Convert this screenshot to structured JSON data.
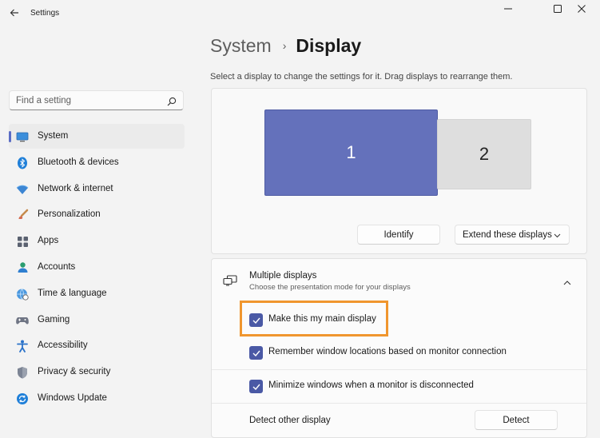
{
  "window": {
    "app_title": "Settings",
    "controls": [
      "minimize-icon",
      "maximize-icon",
      "close-icon"
    ]
  },
  "search": {
    "placeholder": "Find a setting"
  },
  "sidebar": {
    "items": [
      {
        "label": "System",
        "icon": "system-icon",
        "active": true
      },
      {
        "label": "Bluetooth & devices",
        "icon": "bluetooth-icon"
      },
      {
        "label": "Network & internet",
        "icon": "wifi-icon"
      },
      {
        "label": "Personalization",
        "icon": "brush-icon"
      },
      {
        "label": "Apps",
        "icon": "apps-icon"
      },
      {
        "label": "Accounts",
        "icon": "accounts-icon"
      },
      {
        "label": "Time & language",
        "icon": "globe-clock-icon"
      },
      {
        "label": "Gaming",
        "icon": "gamepad-icon"
      },
      {
        "label": "Accessibility",
        "icon": "accessibility-icon"
      },
      {
        "label": "Privacy & security",
        "icon": "shield-icon"
      },
      {
        "label": "Windows Update",
        "icon": "update-icon"
      }
    ]
  },
  "header": {
    "parent": "System",
    "separator": "›",
    "current": "Display",
    "subtitle": "Select a display to change the settings for it. Drag displays to rearrange them."
  },
  "arrangement": {
    "monitors": [
      {
        "number": "1",
        "selected": true
      },
      {
        "number": "2",
        "selected": false
      }
    ],
    "identify_label": "Identify",
    "mode_select": {
      "value": "Extend these displays"
    }
  },
  "multiple_displays": {
    "title": "Multiple displays",
    "description": "Choose the presentation mode for your displays",
    "expanded": true,
    "options": [
      {
        "label": "Make this my main display",
        "checked": true,
        "highlighted": true
      },
      {
        "label": "Remember window locations based on monitor connection",
        "checked": true
      },
      {
        "label": "Minimize windows when a monitor is disconnected",
        "checked": true
      }
    ],
    "detect_label": "Detect other display",
    "detect_button": "Detect"
  },
  "colors": {
    "accent": "#4a59a5",
    "monitor_selected": "#6471bb",
    "monitor_other": "#dedede",
    "highlight_box": "#f0962e",
    "background": "#f3f3f3"
  }
}
